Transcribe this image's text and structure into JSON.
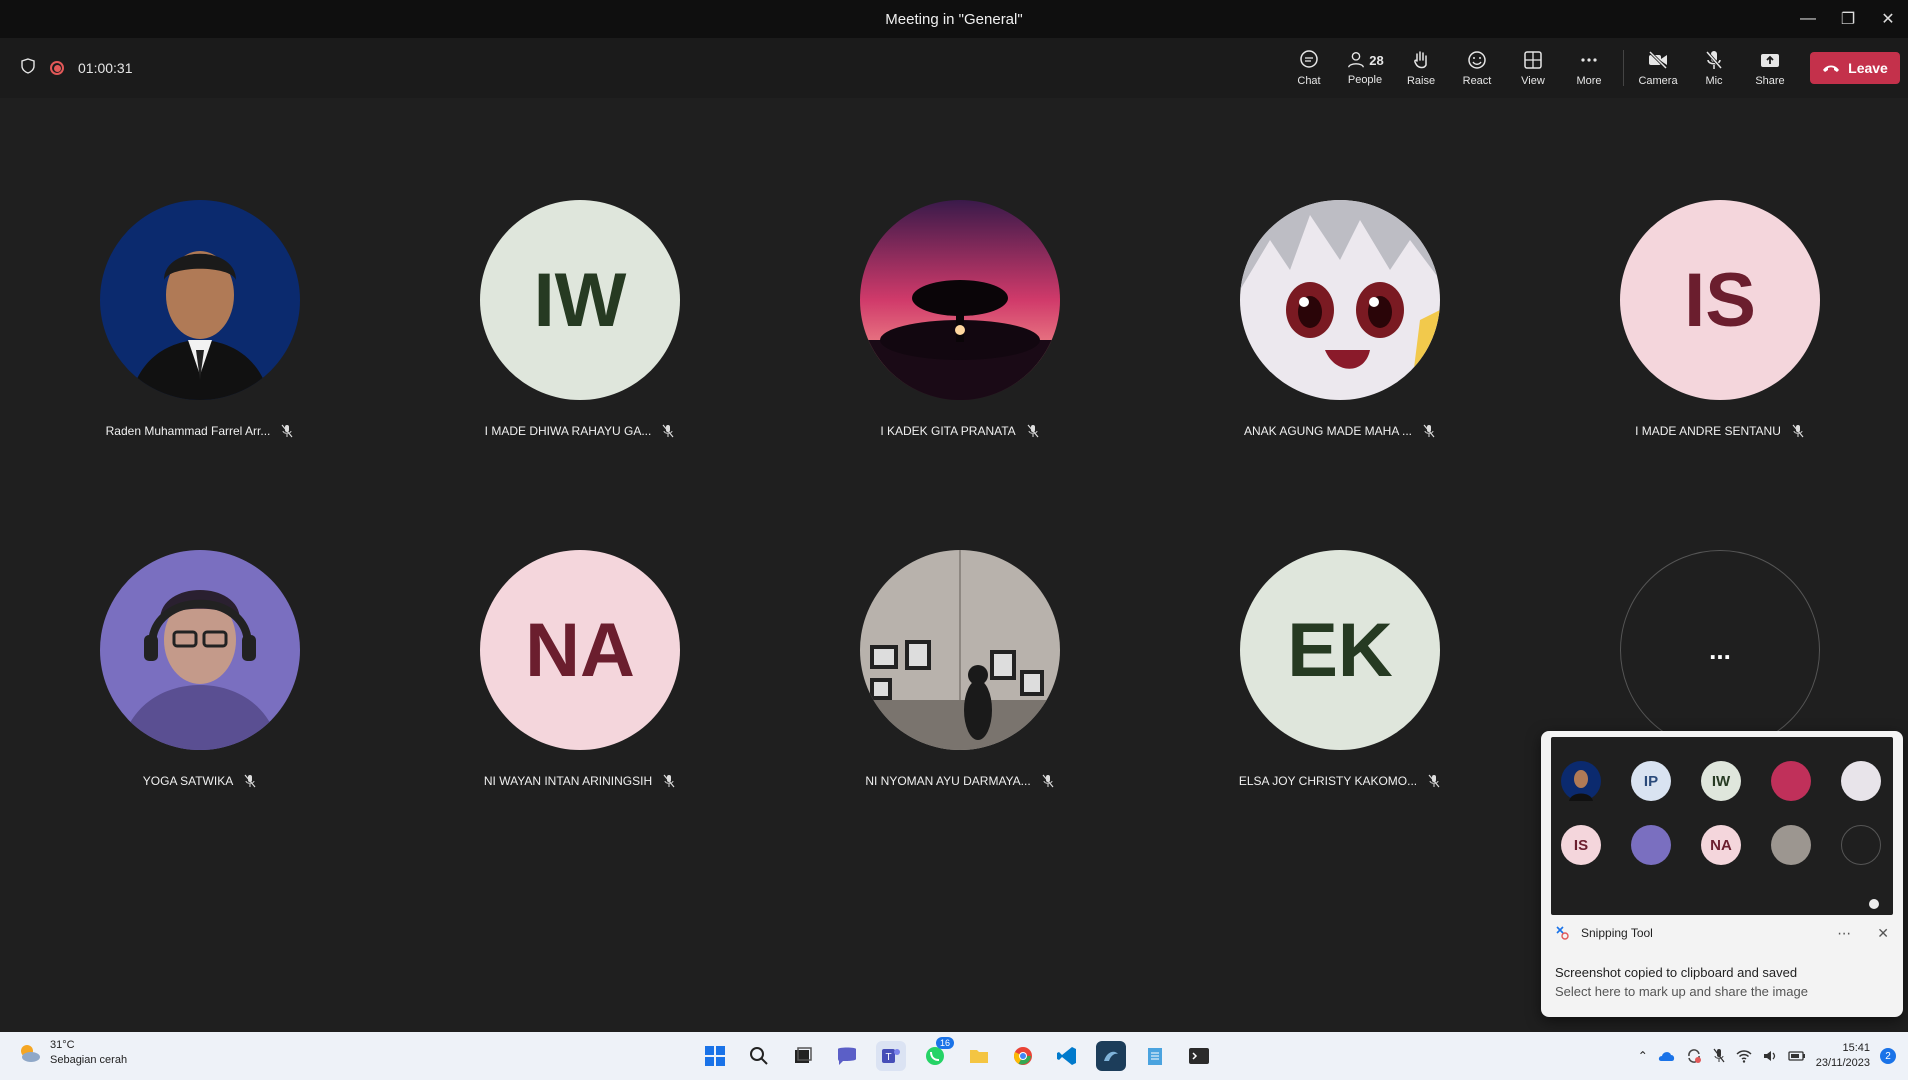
{
  "window": {
    "title": "Meeting in \"General\""
  },
  "toolbar": {
    "timer": "01:00:31",
    "people_count": "28",
    "labels": {
      "chat": "Chat",
      "people": "People",
      "raise": "Raise",
      "react": "React",
      "view": "View",
      "more": "More",
      "camera": "Camera",
      "mic": "Mic",
      "share": "Share",
      "leave": "Leave"
    }
  },
  "participants": [
    {
      "name": "Raden Muhammad Farrel Arr...",
      "initials": "",
      "avatar": "photo-man-suit",
      "bg": "#0b2a6e"
    },
    {
      "name": "I MADE DHIWA RAHAYU GA...",
      "initials": "IW",
      "avatar": "initials",
      "bg": "#dfe6dc",
      "fg": "#263a22"
    },
    {
      "name": "I KADEK GITA PRANATA",
      "initials": "",
      "avatar": "photo-sunset-tree",
      "bg": "#6a1e3c"
    },
    {
      "name": "ANAK AGUNG MADE MAHA ...",
      "initials": "",
      "avatar": "photo-anime-girl",
      "bg": "#e8e4ea"
    },
    {
      "name": "I MADE ANDRE SENTANU",
      "initials": "IS",
      "avatar": "initials",
      "bg": "#f4d6dc",
      "fg": "#6b1e2e"
    },
    {
      "name": "YOGA SATWIKA",
      "initials": "",
      "avatar": "photo-headphones",
      "bg": "#7a6fc0"
    },
    {
      "name": "NI WAYAN INTAN ARININGSIH",
      "initials": "NA",
      "avatar": "initials",
      "bg": "#f4d6dc",
      "fg": "#6b1e2e"
    },
    {
      "name": "NI NYOMAN AYU DARMAYA...",
      "initials": "",
      "avatar": "photo-gallery",
      "bg": "#9c9690"
    },
    {
      "name": "ELSA JOY CHRISTY KAKOMO...",
      "initials": "EK",
      "avatar": "initials",
      "bg": "#dfe6dc",
      "fg": "#263a22"
    }
  ],
  "overflow_tile": {
    "label": "..."
  },
  "toast": {
    "app": "Snipping Tool",
    "message": "Screenshot copied to clipboard and saved",
    "submessage": "Select here to mark up and share the image",
    "mini_initials": [
      "IP",
      "IW",
      "IS",
      "NA"
    ]
  },
  "taskbar": {
    "weather_temp": "31°C",
    "weather_desc": "Sebagian cerah",
    "whatsapp_badge": "16",
    "time": "15:41",
    "date": "23/11/2023",
    "notification_count": "2"
  }
}
